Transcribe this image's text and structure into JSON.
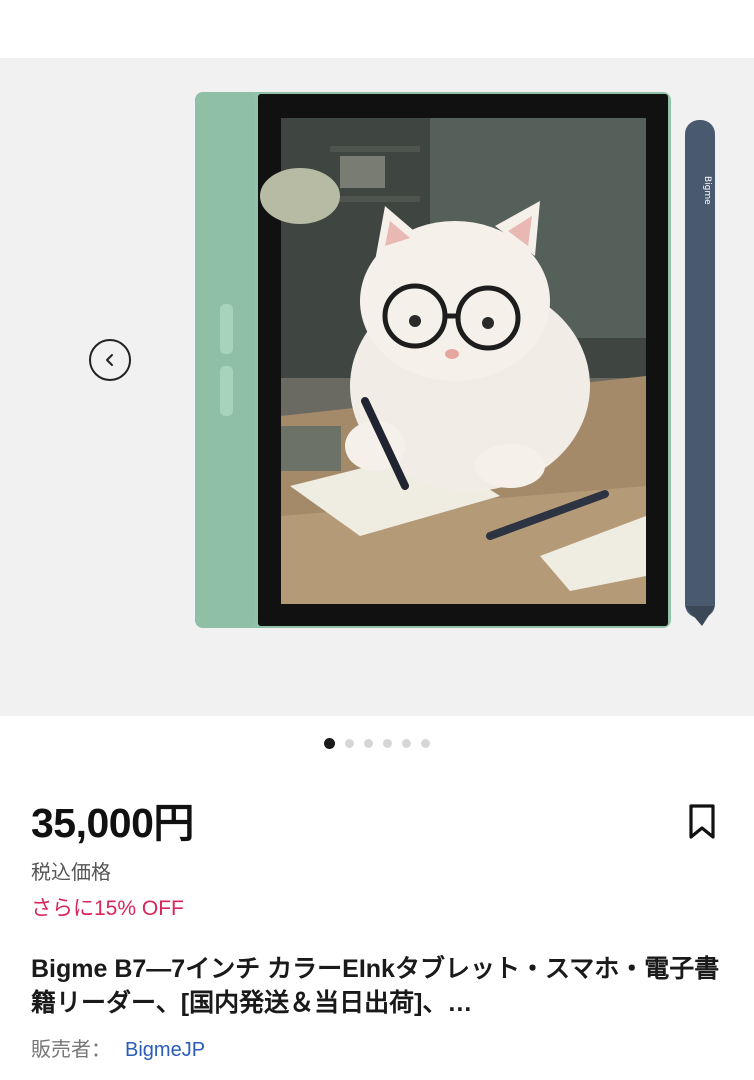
{
  "gallery": {
    "image_count": 6,
    "active_index": 0,
    "device_colors": {
      "bezel": "#92c2a9",
      "screen_frame": "#111111",
      "stylus": "#4a5a6e"
    },
    "stylus_brand": "Bigme",
    "prev_icon": "chevron-left-icon"
  },
  "product": {
    "price": "35,000円",
    "tax_note": "税込価格",
    "discount": "さらに15% OFF",
    "title": "Bigme B7—7インチ カラーEInkタブレット・スマホ・電子書籍リーダー、[国内発送＆当日出荷]、…",
    "bookmark_icon": "bookmark-icon"
  },
  "seller": {
    "label": "販売者：",
    "name": "BigmeJP"
  },
  "colors": {
    "discount": "#d8265c",
    "seller_link": "#2a5cb8",
    "gallery_bg": "#f1f1f1"
  }
}
